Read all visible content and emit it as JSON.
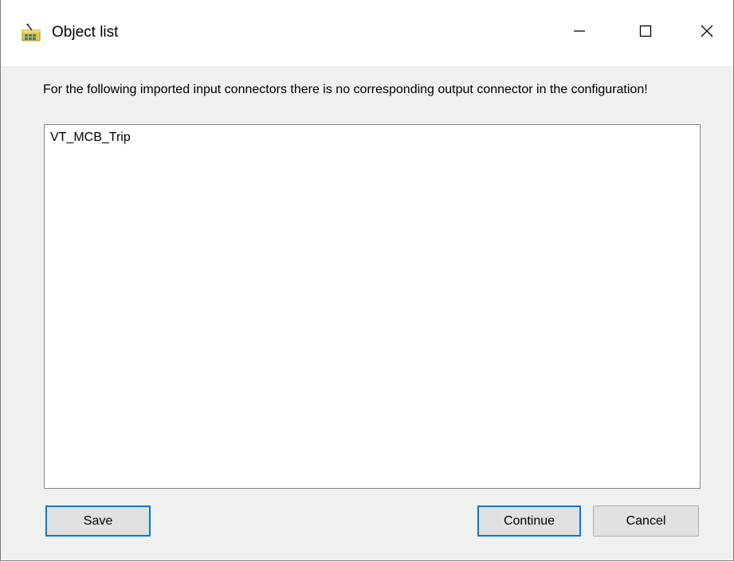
{
  "window": {
    "title": "Object list"
  },
  "titlebar": {
    "icon": "app-config-icon",
    "minimize_icon": "minimize-icon",
    "maximize_icon": "maximize-icon",
    "close_icon": "close-icon"
  },
  "message": "For the following imported input connectors there is no corresponding output connector in the configuration!",
  "list": {
    "items": [
      "VT_MCB_Trip"
    ]
  },
  "buttons": {
    "save": "Save",
    "continue": "Continue",
    "cancel": "Cancel"
  },
  "colors": {
    "focus_accent": "#0078d7",
    "button_face": "#e1e1e1",
    "dialog_background": "#f0f0f0"
  }
}
